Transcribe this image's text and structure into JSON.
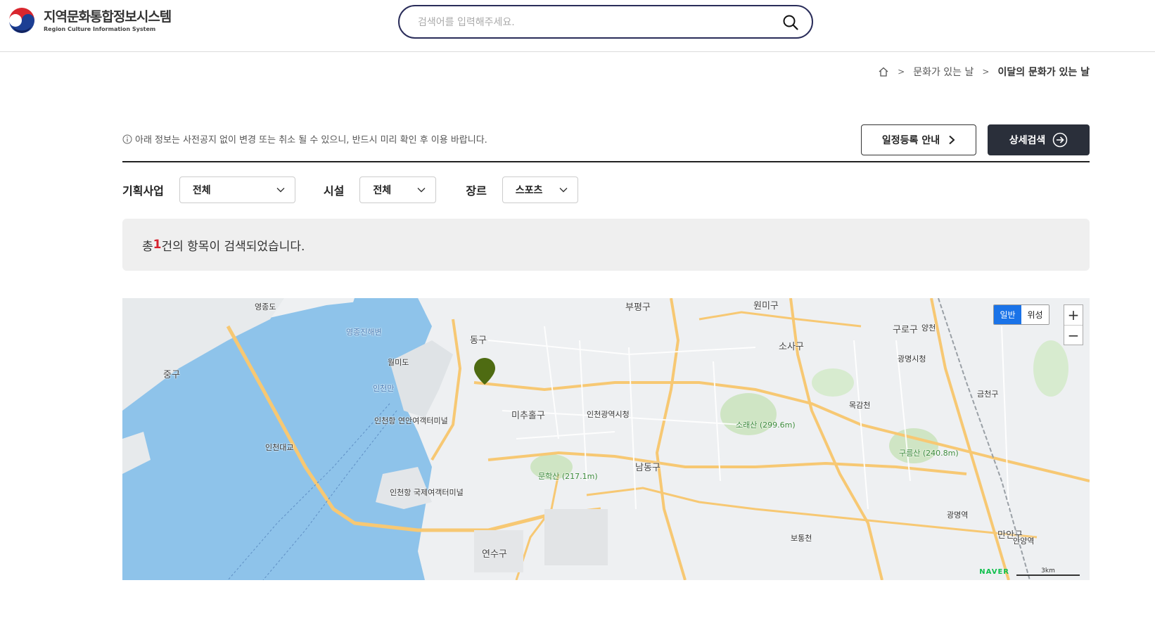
{
  "header": {
    "title": "지역문화통합정보시스템",
    "subtitle": "Region Culture Information System",
    "search_placeholder": "검색어를 입력해주세요."
  },
  "breadcrumb": {
    "items": [
      "문화가 있는 날",
      "이달의 문화가 있는 날"
    ]
  },
  "notice": "아래 정보는 사전공지 없이 변경 또는 취소 될 수 있으니, 반드시 미리 확인 후 이용 바랍니다.",
  "buttons": {
    "guide": "일정등록 안내",
    "detail_search": "상세검색"
  },
  "filters": [
    {
      "label": "기획사업",
      "value": "전체"
    },
    {
      "label": "시설",
      "value": "전체"
    },
    {
      "label": "장르",
      "value": "스포츠"
    }
  ],
  "result": {
    "prefix": "총 ",
    "count": "1",
    "suffix": "건의 항목이 검색되었습니다."
  },
  "map": {
    "type_normal": "일반",
    "type_satellite": "위성",
    "zoom_in": "+",
    "zoom_out": "−",
    "brand": "NAVER",
    "scale": "3km",
    "labels": {
      "yeongjongdo": "영종도",
      "wolmido": "월미도",
      "junggu": "중구",
      "dong_gu": "동구",
      "bupyeonggu": "부평구",
      "wonmigu": "원미구",
      "sosagu": "소사구",
      "gurogu": "구로구",
      "yangcheon": "양천",
      "michuhol": "미추홀구",
      "namdong": "남동구",
      "yeonsu": "연수구",
      "incheon_city_hall": "인천광역시청",
      "incheon_bridge": "인천대교",
      "incheon_port_intl": "인천항 국제여객터미널",
      "incheon_port_coastal": "인천항 연안여객터미널",
      "munhaksan": "문학산 (217.1m)",
      "sorae": "소래산 (299.6m)",
      "gureumsan": "구름산 (240.8m)",
      "gwangmyeong": "광명시청",
      "anyang": "안양역",
      "gwangmyeong_st": "광명역",
      "manangu": "만안구",
      "mokgamcheon": "목감천",
      "bogtongcheon": "보통천",
      "geumcheon": "금천구",
      "yeongjong_jinhae": "영종진해변",
      "wolmido_inlet": "인천만"
    }
  },
  "colors": {
    "accent": "#2a2d5a",
    "dark_button": "#2a2f3a",
    "count_red": "#d6232e",
    "water": "#8ec3ea",
    "marker": "#4e6b12"
  }
}
